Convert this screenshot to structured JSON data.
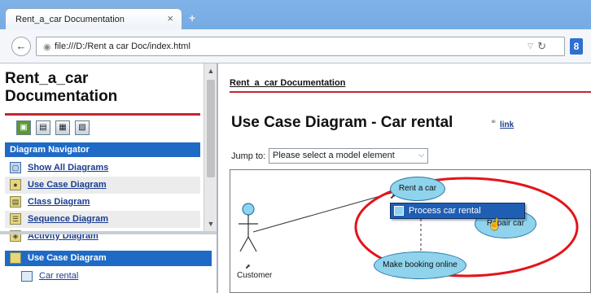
{
  "browser": {
    "tab_title": "Rent_a_car Documentation",
    "tab_close": "×",
    "new_tab": "+",
    "url": "file:///D:/Rent a car Doc/index.html"
  },
  "left": {
    "doc_title": "Rent_a_car Documentation",
    "nav_header": "Diagram Navigator",
    "nav_items": [
      {
        "label": "Show All Diagrams",
        "icon": "diagrams-icon"
      },
      {
        "label": "Use Case Diagram",
        "icon": "use-case-diagram-icon"
      },
      {
        "label": "Class Diagram",
        "icon": "class-diagram-icon"
      },
      {
        "label": "Sequence Diagram",
        "icon": "sequence-diagram-icon"
      },
      {
        "label": "Activity Diagram",
        "icon": "activity-diagram-icon"
      }
    ],
    "section_header": "Use Case Diagram",
    "section_items": [
      {
        "label": "Car rental"
      }
    ]
  },
  "right": {
    "breadcrumb": "Rent_a_car Documentation",
    "page_title": "Use Case Diagram - Car rental",
    "link_label": "link",
    "jump_label": "Jump to:",
    "jump_select": "Please select a model element"
  },
  "diagram": {
    "use_cases": [
      "Rent a car",
      "Repair car",
      "Make booking online"
    ],
    "actor": "Customer",
    "popup_item": "Process car rental"
  },
  "colors": {
    "accent_rule": "#c4262e",
    "header_blue": "#1f6ac5",
    "use_case_fill": "#8fd3ec",
    "highlight_ellipse": "#e3141b"
  }
}
